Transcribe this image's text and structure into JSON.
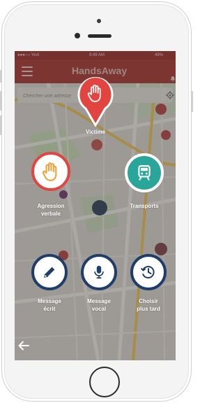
{
  "statusbar": {
    "carrier": "●●●○○ Yext",
    "time": "9:49 AM",
    "battery": "49%"
  },
  "app": {
    "title": "HandsAway",
    "menu_icon": "hamburger-icon",
    "notification_icon": "bell-icon"
  },
  "search": {
    "placeholder": "Chercher une adresse",
    "locate_icon": "crosshair-icon"
  },
  "actions": {
    "victim": {
      "label": "Victime",
      "icon": "raised-hand-icon",
      "color": "#e2453f"
    },
    "aggression": {
      "label_line1": "Agression",
      "label_line2": "verbale",
      "icon": "raised-hand-icon",
      "color": "#e2453f",
      "icon_color": "#f2a23a"
    },
    "transports": {
      "label": "Transports",
      "icon": "train-icon",
      "color": "#2aa59a"
    },
    "text_message": {
      "label_line1": "Message",
      "label_line2": "écrit",
      "icon": "pencil-icon",
      "color": "#1f3d6b"
    },
    "voice_message": {
      "label_line1": "Message",
      "label_line2": "vocal",
      "icon": "microphone-icon",
      "color": "#1f3d6b"
    },
    "later": {
      "label_line1": "Choisir",
      "label_line2": "plus tard",
      "icon": "clock-icon",
      "color": "#1f3d6b"
    }
  },
  "navigation": {
    "back_icon": "back-arrow-icon"
  }
}
